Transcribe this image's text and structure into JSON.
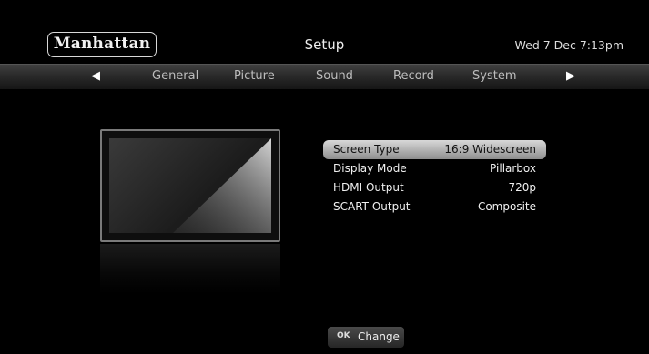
{
  "header": {
    "logo": "Manhattan",
    "title": "Setup",
    "datetime": "Wed 7 Dec 7:13pm"
  },
  "tabs": {
    "left_arrow": "◀",
    "right_arrow": "▶",
    "items": [
      "General",
      "Picture",
      "Sound",
      "Record",
      "System"
    ]
  },
  "settings": [
    {
      "label": "Screen Type",
      "value": "16:9 Widescreen",
      "selected": true
    },
    {
      "label": "Display Mode",
      "value": "Pillarbox",
      "selected": false
    },
    {
      "label": "HDMI Output",
      "value": "720p",
      "selected": false
    },
    {
      "label": "SCART Output",
      "value": "Composite",
      "selected": false
    }
  ],
  "footer": {
    "ok_key": "OK",
    "action": "Change"
  },
  "colors": {
    "background": "#000000",
    "highlight": "#c8c8c8",
    "text": "#f0f0f0"
  }
}
